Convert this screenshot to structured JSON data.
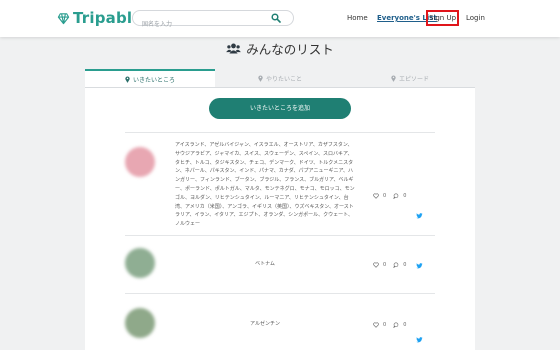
{
  "header": {
    "brand": "Tripable",
    "search_placeholder": "国名を入力",
    "nav": {
      "home": "Home",
      "everyone": "Everyone's List",
      "signup": "Sign Up",
      "login": "Login"
    }
  },
  "page": {
    "title": "みんなのリスト"
  },
  "tabs": [
    {
      "label": "いきたいところ",
      "active": true
    },
    {
      "label": "やりたいこと",
      "active": false
    },
    {
      "label": "エピソード",
      "active": false
    }
  ],
  "add_button": "いきたいところを追加",
  "entries": [
    {
      "text": "アイスランド、アゼルバイジャン、イスラエル、オーストリア、カザフスタン、サウジアラビア、ジャマイカ、スイス、スウェーデン、スペイン、スロバキア、タヒチ、トルコ、タジキスタン、チェコ、デンマーク、ドイツ、トルクメニスタン、ネパール、パキスタン、インド、パナマ、カナダ、パプアニューギニア、ハンガリー、フィンランド、ブータン、ブラジル、フランス、ブルガリア、ベルギー、ポーランド、ポルトガル、マルタ、モンテネグロ、モナコ、モロッコ、モンゴル、ヨルダン、リヒテンシュタイン、ルーマニア、リヒテンシュタイン、台湾、アメリカ（米国）、アンゴラ、イギリス（英国）、ウズベキスタン、オーストラリア、イラン、イタリア、エジプト、オランダ、シンガポール、クウェート、ノルウェー",
      "likes": "0",
      "comments": "0",
      "avatar_color": "#e8a7b2"
    },
    {
      "text": "ベトナム",
      "likes": "0",
      "comments": "0",
      "avatar_color": "#8fae93"
    },
    {
      "text": "アルゼンチン",
      "likes": "0",
      "comments": "0",
      "avatar_color": "#8fa98a"
    }
  ],
  "colors": {
    "brand": "#2a9d8f",
    "button": "#1f7f73",
    "highlight": "#e0151b",
    "twitter": "#1da1f2"
  },
  "icons": [
    "logo-icon",
    "search-icon",
    "users-icon",
    "pin-icon",
    "heart-icon",
    "comment-icon",
    "twitter-icon"
  ]
}
